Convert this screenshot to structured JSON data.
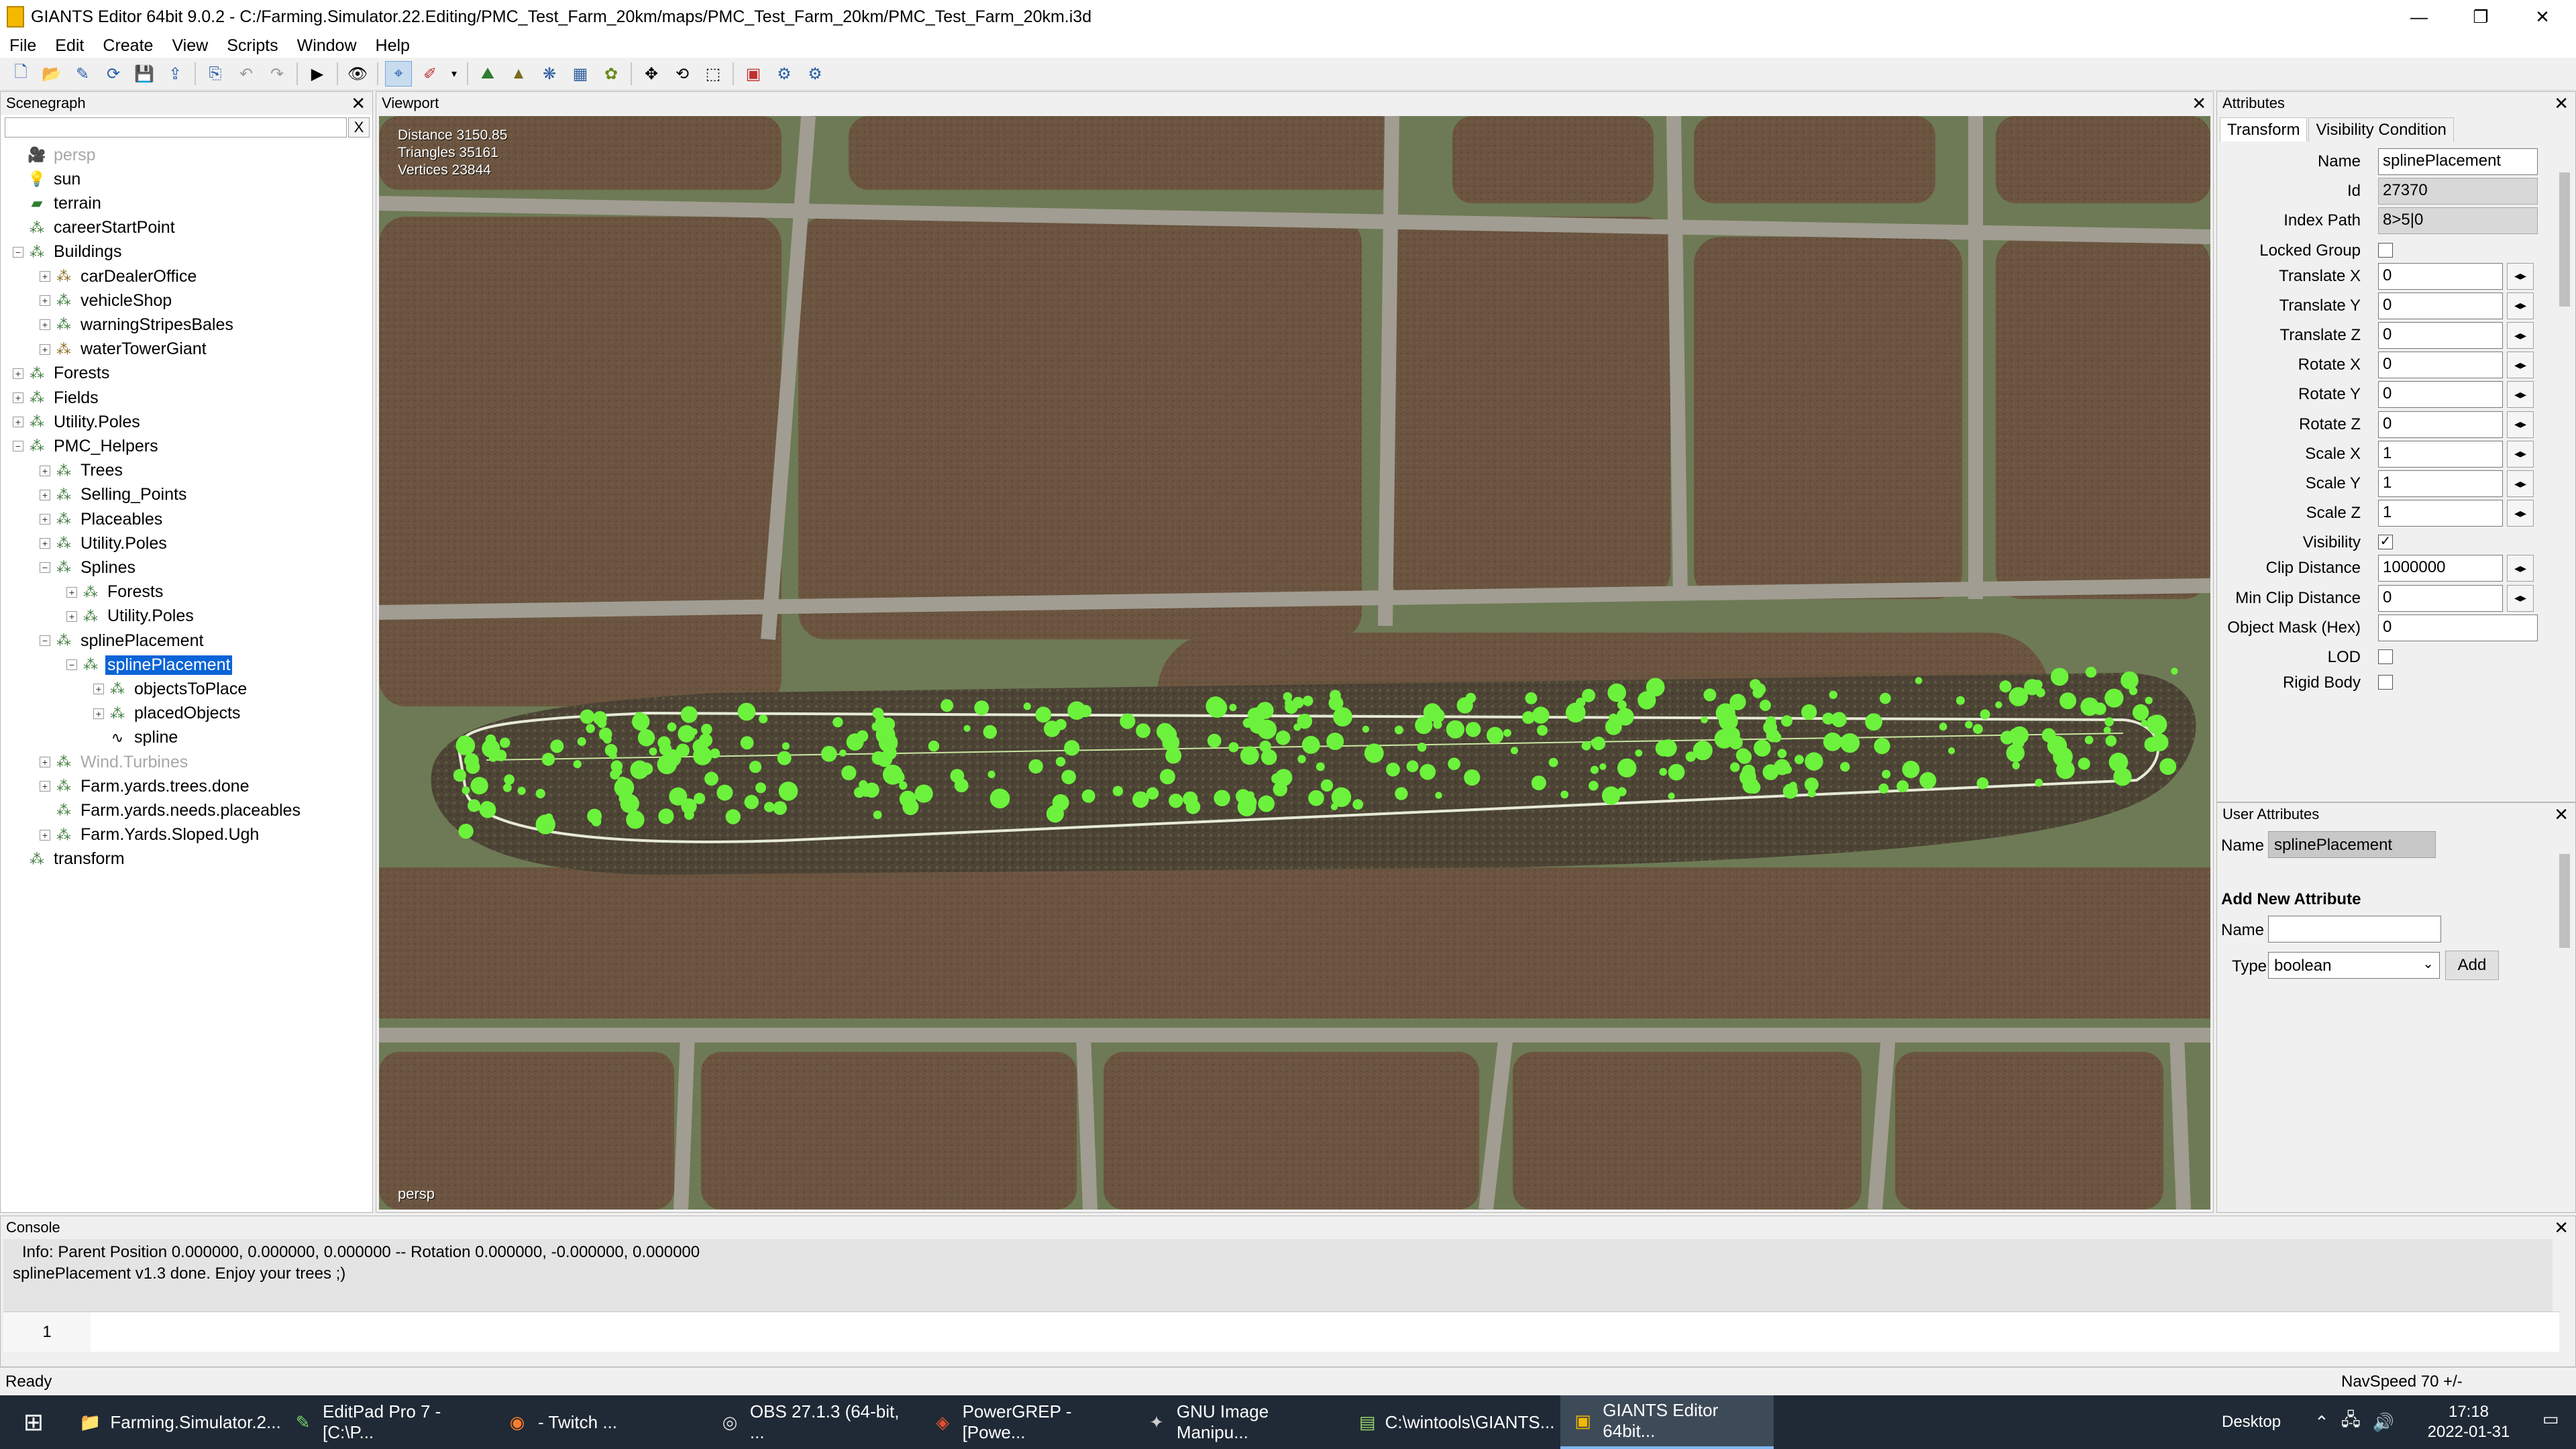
{
  "window": {
    "title": "GIANTS Editor 64bit 9.0.2 - C:/Farming.Simulator.22.Editing/PMC_Test_Farm_20km/maps/PMC_Test_Farm_20km/PMC_Test_Farm_20km.i3d",
    "minimize": "—",
    "maximize": "❐",
    "close": "✕"
  },
  "menu": [
    "File",
    "Edit",
    "Create",
    "View",
    "Scripts",
    "Window",
    "Help"
  ],
  "scenegraph": {
    "title": "Scenegraph",
    "close": "✕",
    "search_clear": "X",
    "items": [
      {
        "label": "persp",
        "icon": "camera-icon",
        "level": 0,
        "expander": "",
        "state": "gray"
      },
      {
        "label": "sun",
        "icon": "light-bulb-icon",
        "level": 0,
        "expander": ""
      },
      {
        "label": "terrain",
        "icon": "terrain-icon",
        "level": 0,
        "expander": ""
      },
      {
        "label": "careerStartPoint",
        "icon": "transform-group-icon",
        "level": 0,
        "expander": ""
      },
      {
        "label": "Buildings",
        "icon": "transform-group-icon",
        "level": 0,
        "expander": "−"
      },
      {
        "label": "carDealerOffice",
        "icon": "building-icon",
        "level": 1,
        "expander": "+"
      },
      {
        "label": "vehicleShop",
        "icon": "transform-group-icon",
        "level": 1,
        "expander": "+"
      },
      {
        "label": "warningStripesBales",
        "icon": "transform-group-icon",
        "level": 1,
        "expander": "+"
      },
      {
        "label": "waterTowerGiant",
        "icon": "building-icon",
        "level": 1,
        "expander": "+"
      },
      {
        "label": "Forests",
        "icon": "transform-group-icon",
        "level": 0,
        "expander": "+"
      },
      {
        "label": "Fields",
        "icon": "transform-group-icon",
        "level": 0,
        "expander": "+"
      },
      {
        "label": "Utility.Poles",
        "icon": "transform-group-icon",
        "level": 0,
        "expander": "+"
      },
      {
        "label": "PMC_Helpers",
        "icon": "transform-group-icon",
        "level": 0,
        "expander": "−"
      },
      {
        "label": "Trees",
        "icon": "transform-group-icon",
        "level": 1,
        "expander": "+"
      },
      {
        "label": "Selling_Points",
        "icon": "transform-group-icon",
        "level": 1,
        "expander": "+"
      },
      {
        "label": "Placeables",
        "icon": "transform-group-icon",
        "level": 1,
        "expander": "+"
      },
      {
        "label": "Utility.Poles",
        "icon": "transform-group-icon",
        "level": 1,
        "expander": "+"
      },
      {
        "label": "Splines",
        "icon": "transform-group-icon",
        "level": 1,
        "expander": "−"
      },
      {
        "label": "Forests",
        "icon": "transform-group-icon",
        "level": 2,
        "expander": "+"
      },
      {
        "label": "Utility.Poles",
        "icon": "transform-group-icon",
        "level": 2,
        "expander": "+"
      },
      {
        "label": "splinePlacement",
        "icon": "transform-group-icon",
        "level": 1,
        "expander": "−"
      },
      {
        "label": "splinePlacement",
        "icon": "transform-group-icon",
        "level": 2,
        "expander": "−",
        "state": "selected"
      },
      {
        "label": "objectsToPlace",
        "icon": "transform-group-icon",
        "level": 3,
        "expander": "+"
      },
      {
        "label": "placedObjects",
        "icon": "transform-group-icon",
        "level": 3,
        "expander": "+"
      },
      {
        "label": "spline",
        "icon": "spline-icon",
        "level": 3,
        "expander": ""
      },
      {
        "label": "Wind.Turbines",
        "icon": "transform-group-icon",
        "level": 1,
        "expander": "+",
        "state": "gray"
      },
      {
        "label": "Farm.yards.trees.done",
        "icon": "transform-group-icon",
        "level": 1,
        "expander": "+"
      },
      {
        "label": "Farm.yards.needs.placeables",
        "icon": "transform-group-icon",
        "level": 1,
        "expander": ""
      },
      {
        "label": "Farm.Yards.Sloped.Ugh",
        "icon": "transform-group-icon",
        "level": 1,
        "expander": "+"
      },
      {
        "label": "transform",
        "icon": "transform-group-icon",
        "level": 0,
        "expander": ""
      }
    ]
  },
  "viewport": {
    "title": "Viewport",
    "close": "✕",
    "stats": [
      "Distance 3150.85",
      "Triangles 35161",
      "Vertices 23844"
    ],
    "camera": "persp"
  },
  "attributes": {
    "title": "Attributes",
    "close": "✕",
    "tabs": [
      "Transform",
      "Visibility Condition"
    ],
    "fields": [
      {
        "label": "Name",
        "value": "splinePlacement",
        "kind": "text"
      },
      {
        "label": "Id",
        "value": "27370",
        "kind": "readonly"
      },
      {
        "label": "Index Path",
        "value": "8>5|0",
        "kind": "readonly"
      },
      {
        "label": "Locked Group",
        "value": "",
        "kind": "checkbox"
      },
      {
        "label": "Translate X",
        "value": "0",
        "kind": "spin"
      },
      {
        "label": "Translate Y",
        "value": "0",
        "kind": "spin"
      },
      {
        "label": "Translate Z",
        "value": "0",
        "kind": "spin"
      },
      {
        "label": "Rotate X",
        "value": "0",
        "kind": "spin"
      },
      {
        "label": "Rotate Y",
        "value": "0",
        "kind": "spin"
      },
      {
        "label": "Rotate Z",
        "value": "0",
        "kind": "spin"
      },
      {
        "label": "Scale X",
        "value": "1",
        "kind": "spin"
      },
      {
        "label": "Scale Y",
        "value": "1",
        "kind": "spin"
      },
      {
        "label": "Scale Z",
        "value": "1",
        "kind": "spin"
      },
      {
        "label": "Visibility",
        "value": "✓",
        "kind": "checkbox"
      },
      {
        "label": "Clip Distance",
        "value": "1000000",
        "kind": "spin"
      },
      {
        "label": "Min Clip Distance",
        "value": "0",
        "kind": "spin"
      },
      {
        "label": "Object Mask (Hex)",
        "value": "0",
        "kind": "text"
      },
      {
        "label": "LOD",
        "value": "",
        "kind": "checkbox"
      },
      {
        "label": "Rigid Body",
        "value": "",
        "kind": "checkbox"
      }
    ]
  },
  "user_attributes": {
    "title": "User Attributes",
    "close": "✕",
    "name_label": "Name",
    "name_value": "splinePlacement",
    "add_heading": "Add New Attribute",
    "new_name_label": "Name",
    "new_name_value": "",
    "type_label": "Type",
    "type_value": "boolean",
    "add_button": "Add"
  },
  "console": {
    "title": "Console",
    "close": "✕",
    "lines": [
      "Info: Parent Position 0.000000, 0.000000, 0.000000 -- Rotation 0.000000, -0.000000, 0.000000",
      "splinePlacement v1.3 done. Enjoy your trees ;)"
    ],
    "line_number": "1"
  },
  "status": {
    "left": "Ready",
    "right": "NavSpeed 70 +/-"
  },
  "taskbar": {
    "items": [
      {
        "label": "Farming.Simulator.2...",
        "icon": "folder-icon",
        "active": false
      },
      {
        "label": "EditPad Pro 7 - [C:\\P...",
        "icon": "editpad-icon",
        "active": false
      },
      {
        "label": "- Twitch ...",
        "icon": "firefox-icon",
        "active": false
      },
      {
        "label": "OBS 27.1.3 (64-bit, ...",
        "icon": "obs-icon",
        "active": false
      },
      {
        "label": "PowerGREP - [Powe...",
        "icon": "powergrep-icon",
        "active": false
      },
      {
        "label": "GNU Image Manipu...",
        "icon": "gimp-icon",
        "active": false
      },
      {
        "label": "C:\\wintools\\GIANTS...",
        "icon": "console-app-icon",
        "active": false
      },
      {
        "label": "GIANTS Editor 64bit...",
        "icon": "giants-editor-icon",
        "active": true
      }
    ],
    "desktop": "Desktop",
    "time": "17:18",
    "date": "2022-01-31"
  },
  "colors": {
    "selection": "#0a64d6",
    "field_brown": "#6b5540",
    "grass": "#6e7a55",
    "road": "#9d9a8f",
    "tree_green": "#6cf23c",
    "taskbar": "#1f2a36"
  }
}
